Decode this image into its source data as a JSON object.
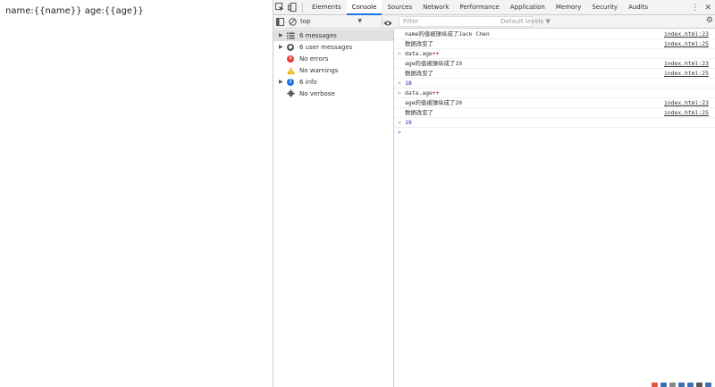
{
  "page": {
    "text": "name:{{name}} age:{{age}}"
  },
  "devtools": {
    "tabs": [
      {
        "label": "Elements"
      },
      {
        "label": "Console"
      },
      {
        "label": "Sources"
      },
      {
        "label": "Network"
      },
      {
        "label": "Performance"
      },
      {
        "label": "Application"
      },
      {
        "label": "Memory"
      },
      {
        "label": "Security"
      },
      {
        "label": "Audits"
      }
    ],
    "active_tab": "Console",
    "toolbar": {
      "context": "top",
      "filter_placeholder": "Filter",
      "levels": "Default levels ▼"
    },
    "sidebar": [
      {
        "label": "6 messages",
        "icon": "list-icon",
        "arrow": "▶"
      },
      {
        "label": "6 user messages",
        "icon": "user-icon",
        "arrow": "▶"
      },
      {
        "label": "No errors",
        "icon": "error-icon",
        "arrow": ""
      },
      {
        "label": "No warnings",
        "icon": "warning-icon",
        "arrow": ""
      },
      {
        "label": "6 info",
        "icon": "info-icon",
        "arrow": "▶"
      },
      {
        "label": "No verbose",
        "icon": "verbose-icon",
        "arrow": ""
      }
    ],
    "console": {
      "rows": [
        {
          "type": "log",
          "text": "name的值被操纵成了Jack Chen",
          "source": "index.html:23"
        },
        {
          "type": "log",
          "text": "数据改变了",
          "source": "index.html:25"
        },
        {
          "type": "cmd",
          "prefix": "data.age",
          "op": "++",
          "source": ""
        },
        {
          "type": "log",
          "text": "age的值被操纵成了19",
          "source": "index.html:23"
        },
        {
          "type": "log",
          "text": "数据改变了",
          "source": "index.html:25"
        },
        {
          "type": "result",
          "text": "18",
          "source": ""
        },
        {
          "type": "cmd",
          "prefix": "data.age",
          "op": "++",
          "source": ""
        },
        {
          "type": "log",
          "text": "age的值被操纵成了20",
          "source": "index.html:23"
        },
        {
          "type": "log",
          "text": "数据改变了",
          "source": "index.html:25"
        },
        {
          "type": "result",
          "text": "19",
          "source": ""
        }
      ]
    },
    "colors": {
      "accent": "#1a73e8",
      "error": "#e53935",
      "warning": "#f2b600"
    }
  }
}
